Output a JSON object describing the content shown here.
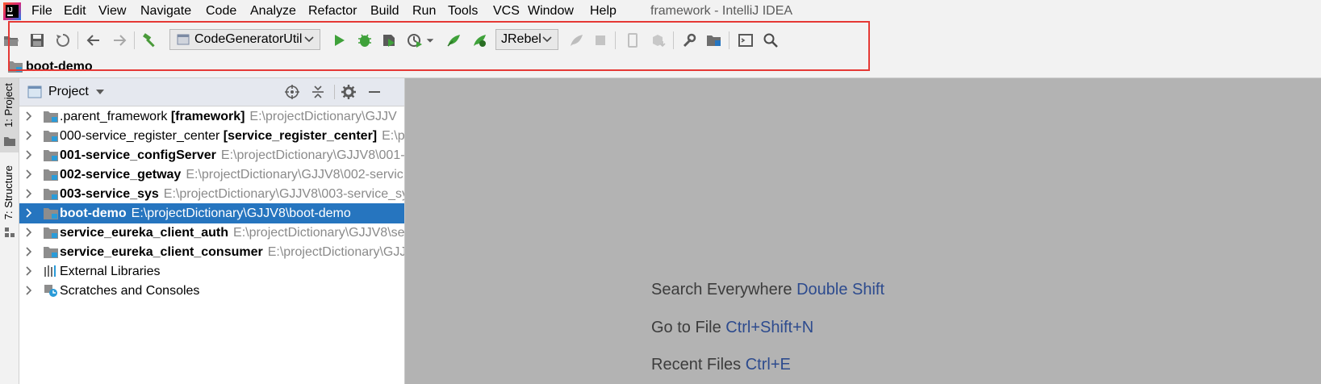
{
  "window": {
    "title": "framework - IntelliJ IDEA"
  },
  "menu": [
    "File",
    "Edit",
    "View",
    "Navigate",
    "Code",
    "Analyze",
    "Refactor",
    "Build",
    "Run",
    "Tools",
    "VCS",
    "Window",
    "Help"
  ],
  "toolbar": {
    "run_config": "CodeGeneratorUtil",
    "jrebel_config": "JRebel"
  },
  "navbar": {
    "breadcrumb": "boot-demo"
  },
  "sidebar_tabs": {
    "project": "1: Project",
    "structure": "7: Structure"
  },
  "project_panel": {
    "title": "Project",
    "tree": [
      {
        "name": ".parent_framework",
        "module": "[framework]",
        "path": "E:\\projectDictionary\\GJJV",
        "bold": false,
        "selected": false,
        "icon": "module-folder-icon"
      },
      {
        "name": "000-service_register_center",
        "module": "[service_register_center]",
        "path": "E:\\p",
        "bold": false,
        "selected": false,
        "icon": "module-folder-icon"
      },
      {
        "name": "001-service_configServer",
        "module": "",
        "path": "E:\\projectDictionary\\GJJV8\\001-",
        "bold": true,
        "selected": false,
        "icon": "module-folder-icon"
      },
      {
        "name": "002-service_getway",
        "module": "",
        "path": "E:\\projectDictionary\\GJJV8\\002-servic",
        "bold": true,
        "selected": false,
        "icon": "module-folder-icon"
      },
      {
        "name": "003-service_sys",
        "module": "",
        "path": "E:\\projectDictionary\\GJJV8\\003-service_sy",
        "bold": true,
        "selected": false,
        "icon": "module-folder-icon"
      },
      {
        "name": "boot-demo",
        "module": "",
        "path": "E:\\projectDictionary\\GJJV8\\boot-demo",
        "bold": true,
        "selected": true,
        "icon": "module-folder-icon"
      },
      {
        "name": "service_eureka_client_auth",
        "module": "",
        "path": "E:\\projectDictionary\\GJJV8\\ser",
        "bold": true,
        "selected": false,
        "icon": "module-folder-icon"
      },
      {
        "name": "service_eureka_client_consumer",
        "module": "",
        "path": "E:\\projectDictionary\\GJJV",
        "bold": true,
        "selected": false,
        "icon": "module-folder-icon"
      },
      {
        "name": "External Libraries",
        "module": "",
        "path": "",
        "bold": false,
        "selected": false,
        "icon": "libraries-icon"
      },
      {
        "name": "Scratches and Consoles",
        "module": "",
        "path": "",
        "bold": false,
        "selected": false,
        "icon": "scratches-icon"
      }
    ]
  },
  "editor_hints": [
    {
      "label": "Search Everywhere",
      "key": "Double Shift"
    },
    {
      "label": "Go to File",
      "key": "Ctrl+Shift+N"
    },
    {
      "label": "Recent Files",
      "key": "Ctrl+E"
    }
  ],
  "colors": {
    "selection": "#2675bf",
    "highlight_box": "#e53935",
    "hint_key": "#2d4b8e",
    "editor_bg": "#b3b3b3"
  }
}
